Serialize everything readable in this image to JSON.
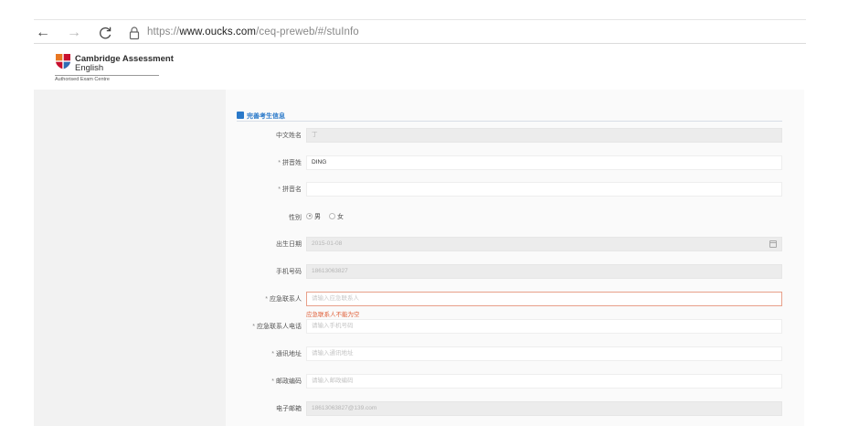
{
  "browser": {
    "back_icon": "←",
    "forward_icon": "→",
    "reload_icon": "C",
    "url_prefix": "https://",
    "url_host": "www.oucks.com",
    "url_path": "/ceq-preweb/#/stuInfo"
  },
  "brand": {
    "name": "Cambridge Assessment",
    "subname": "English",
    "tagline": "Authorised Exam Centre",
    "shield_colors": [
      "#c8102e",
      "#e87722",
      "#2f6db5"
    ]
  },
  "section": {
    "title": "完善考生信息",
    "accent_color": "#2a79c9"
  },
  "form": {
    "chinese_name": {
      "label": "中文姓名",
      "value": "丁",
      "required": false,
      "disabled": true
    },
    "pinyin_surname": {
      "label": "拼音姓",
      "value": "DING",
      "required": true,
      "required_mark": "*"
    },
    "pinyin_given": {
      "label": "拼音名",
      "value": "",
      "required": true,
      "required_mark": "*"
    },
    "gender": {
      "label": "性别",
      "options": [
        "男",
        "女"
      ],
      "selected": "男"
    },
    "birth_date": {
      "label": "出生日期",
      "value": "2015-01-08",
      "disabled": true,
      "icon": "calendar-icon"
    },
    "mobile": {
      "label": "手机号码",
      "value": "18613063827",
      "disabled": true
    },
    "emergency_contact": {
      "label": "应急联系人",
      "placeholder": "请输入应急联系人",
      "required": true,
      "required_mark": "*",
      "error": "应急联系人不能为空"
    },
    "emergency_phone": {
      "label": "应急联系人电话",
      "placeholder": "请输入手机号码",
      "required": true,
      "required_mark": "*"
    },
    "address": {
      "label": "通讯地址",
      "placeholder": "请输入通讯地址",
      "required": true,
      "required_mark": "*"
    },
    "postcode": {
      "label": "邮政编码",
      "placeholder": "请输入邮政编码",
      "required": true,
      "required_mark": "*"
    },
    "email": {
      "label": "电子邮箱",
      "value": "18613063827@139.com",
      "disabled": true
    }
  },
  "colors": {
    "error": "#e0603a",
    "page_bg": "#f2f2f2"
  }
}
